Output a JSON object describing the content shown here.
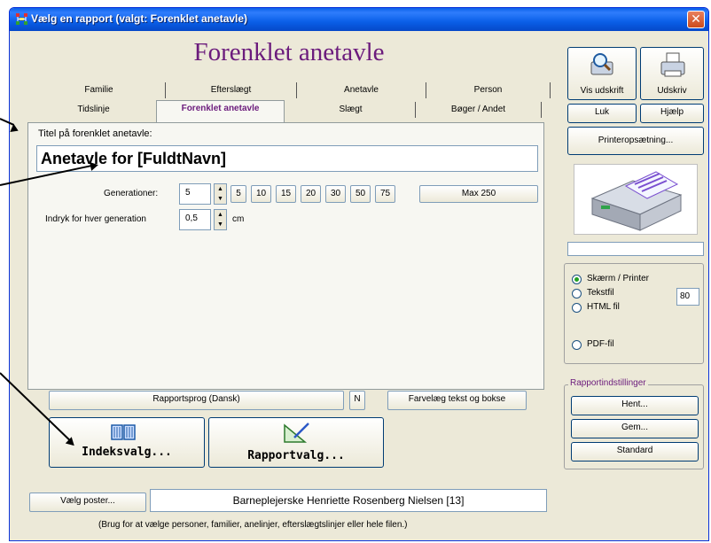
{
  "window": {
    "title": "Vælg en rapport (valgt: Forenklet anetavle)",
    "close_label": "✕"
  },
  "heading": "Forenklet anetavle",
  "tabs_row1": [
    "Familie",
    "Efterslægt",
    "Anetavle",
    "Person"
  ],
  "tabs_row2": [
    "Tidslinje",
    "Forenklet anetavle",
    "Slægt",
    "Bøger / Andet"
  ],
  "form": {
    "title_label": "Titel på forenklet anetavle:",
    "title_value": "Anetavle for [FuldtNavn]",
    "generations_label": "Generationer:",
    "generations_value": "5",
    "generation_buttons": [
      "5",
      "10",
      "15",
      "20",
      "30",
      "50",
      "75",
      "Max 250"
    ],
    "indent_label": "Indryk for hver generation",
    "indent_value": "0,5",
    "indent_unit": "cm"
  },
  "bottom": {
    "language_button": "Rapportsprog (Dansk)",
    "n_button": "N",
    "color_button": "Farvelæg tekst og bokse",
    "index_button": "Indeksvalg...",
    "report_button": "Rapportvalg...",
    "select_button": "Vælg poster...",
    "selected_person": "Barneplejerske Henriette Rosenberg Nielsen [13]",
    "hint": "(Brug for at vælge personer, familier, anelinjer, efterslægtslinjer eller hele filen.)"
  },
  "right": {
    "preview_label": "Vis udskrift",
    "print_label": "Udskriv",
    "close_label": "Luk",
    "help_label": "Hjælp",
    "printer_setup_label": "Printeropsætning...",
    "output_options": [
      "Skærm / Printer",
      "Tekstfil",
      "HTML fil",
      "PDF-fil"
    ],
    "text_width_value": "80",
    "group_title": "Rapportindstillinger",
    "fetch_label": "Hent...",
    "save_label": "Gem...",
    "default_label": "Standard"
  },
  "icons": [
    "app-icon",
    "magnifier-icon",
    "printer-icon",
    "book-icon",
    "ruler-icon"
  ],
  "colors": {
    "accent": "#6b1b7c",
    "titlebar": "#0a5fe8",
    "window": "#ece9d8"
  }
}
